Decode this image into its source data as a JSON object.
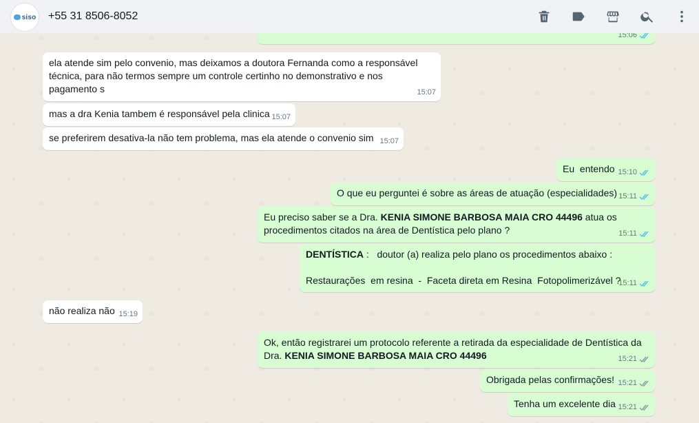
{
  "header": {
    "avatar_label": "siso",
    "contact": "+55 31 8506-8052",
    "icons": [
      "trash-icon",
      "label-icon",
      "store-icon",
      "search-icon",
      "menu-dots-icon"
    ]
  },
  "top_partial_message": {
    "time": "15:06"
  },
  "messages": [
    {
      "dir": "in",
      "text": "ela atende sim pelo convenio, mas deixamos a doutora Fernanda como a responsável técnica, para não termos sempre um controle certinho no demonstrativo e nos pagamento s",
      "time": "15:07"
    },
    {
      "dir": "in",
      "text": "mas a dra Kenia tambem é responsável pela clinica",
      "time": "15:07"
    },
    {
      "dir": "in",
      "text": "se preferirem desativa-la não tem problema, mas ela atende o convenio sim",
      "time": "15:07"
    },
    {
      "dir": "out",
      "text": "Eu  entendo",
      "time": "15:10",
      "status": "read"
    },
    {
      "dir": "out",
      "text": "O que eu perguntei é sobre as áreas de atuação (especialidades)",
      "time": "15:11",
      "status": "read"
    },
    {
      "dir": "out",
      "text_pre": "Eu preciso saber se a Dra. ",
      "bold": "KENIA SIMONE BARBOSA MAIA CRO 44496",
      "text_post": " atua os procedimentos citados na área de Dentística pelo plano ?",
      "time": "15:11",
      "status": "read"
    },
    {
      "dir": "out",
      "bold": "DENTÍSTICA",
      "text_post": " :   doutor (a) realiza pelo plano os procedimentos abaixo :",
      "line2": "Restaurações  em resina  -  Faceta direta em Resina  Fotopolimerizável ?",
      "time": "15:11",
      "status": "read"
    },
    {
      "dir": "in",
      "text": "não realiza não",
      "time": "15:19"
    },
    {
      "dir": "out",
      "text_pre": "Ok, então registrarei um protocolo referente a retirada da especialidade de Dentística da Dra. ",
      "bold": "KENIA SIMONE BARBOSA MAIA CRO 44496",
      "time": "15:21",
      "status": "delivered"
    },
    {
      "dir": "out",
      "text": "Obrigada pelas confirmações!",
      "time": "15:21",
      "status": "delivered"
    },
    {
      "dir": "out",
      "text": "Tenha um excelente dia",
      "time": "15:21",
      "status": "delivered"
    }
  ],
  "colors": {
    "header_bg": "#f0f2f5",
    "chat_bg": "#efeae2",
    "incoming_bubble": "#ffffff",
    "outgoing_bubble": "#d9fdd3",
    "read_tick": "#53bdeb",
    "delivered_tick": "#8696a0"
  }
}
